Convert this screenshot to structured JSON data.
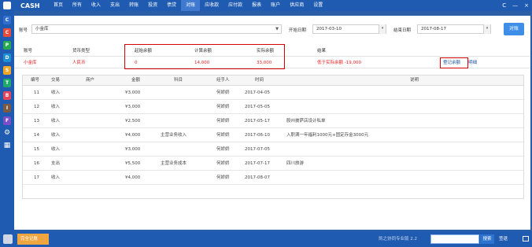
{
  "app": {
    "title": "CASH"
  },
  "menu": [
    "首页",
    "所有",
    "收入",
    "支出",
    "转账",
    "投资",
    "债贷",
    "对账",
    "应收款",
    "应付款",
    "报表",
    "账户",
    "供应商",
    "设置"
  ],
  "menu_active": "对账",
  "window_controls": [
    "C",
    "—",
    "×"
  ],
  "sidebar_icons": [
    {
      "letter": "C",
      "color": "#2f6fd0"
    },
    {
      "letter": "C",
      "color": "#e64b3b"
    },
    {
      "letter": "P",
      "color": "#27a94f"
    },
    {
      "letter": "D",
      "color": "#1d8fd6"
    },
    {
      "letter": "S",
      "color": "#f2a627"
    },
    {
      "letter": "T",
      "color": "#1fa86b"
    },
    {
      "letter": "B",
      "color": "#e3465c"
    },
    {
      "letter": "I",
      "color": "#7a5a44"
    },
    {
      "letter": "F",
      "color": "#7b4ec7"
    }
  ],
  "filter": {
    "account_label": "账号",
    "account_value": "小金库",
    "start_label": "开始日期",
    "start_value": "2017-03-10",
    "end_label": "结束日期",
    "end_value": "2017-08-17",
    "reconcile_button": "对账"
  },
  "summary": {
    "headers": [
      "账号",
      "货币类型",
      "起始余额",
      "计算余额",
      "实际余额",
      "结果"
    ],
    "row": {
      "account": "小金库",
      "currency": "人民币",
      "start_balance": "0",
      "calculated_balance": "14,000",
      "actual_balance": "33,000",
      "result": "低于实际余额 -19,000",
      "register_link": "登记余额",
      "detail_link": "明细"
    }
  },
  "details": {
    "headers": [
      "编号",
      "交易",
      "商户",
      "金额",
      "科目",
      "经手人",
      "时间",
      "说明"
    ],
    "rows": [
      {
        "id": "11",
        "type": "收入",
        "merchant": "",
        "amount": "¥3,000",
        "subject": "",
        "handler": "何娇娇",
        "date": "2017-04-05",
        "note": ""
      },
      {
        "id": "12",
        "type": "收入",
        "merchant": "",
        "amount": "¥3,000",
        "subject": "",
        "handler": "何娇娇",
        "date": "2017-05-05",
        "note": ""
      },
      {
        "id": "13",
        "type": "收入",
        "merchant": "",
        "amount": "¥2,500",
        "subject": "",
        "handler": "何娇娇",
        "date": "2017-05-17",
        "note": "股州披萨店设计私单"
      },
      {
        "id": "14",
        "type": "收入",
        "merchant": "",
        "amount": "¥4,000",
        "subject": "主营业务收入",
        "handler": "何娇娇",
        "date": "2017-06-10",
        "note": "入职满一年福利1000元+固定存金3000元"
      },
      {
        "id": "15",
        "type": "收入",
        "merchant": "",
        "amount": "¥3,000",
        "subject": "",
        "handler": "何娇娇",
        "date": "2017-07-05",
        "note": ""
      },
      {
        "id": "16",
        "type": "支出",
        "merchant": "",
        "amount": "¥5,500",
        "subject": "主营业务成本",
        "handler": "何娇娇",
        "date": "2017-07-17",
        "note": "四川旅游"
      },
      {
        "id": "17",
        "type": "收入",
        "merchant": "",
        "amount": "¥4,000",
        "subject": "",
        "handler": "何娇娇",
        "date": "2017-08-07",
        "note": ""
      }
    ]
  },
  "status": {
    "task_label": "完全记账",
    "version": "凯之协同专业版 2.2",
    "search_button": "搜索",
    "signout": "签退"
  }
}
